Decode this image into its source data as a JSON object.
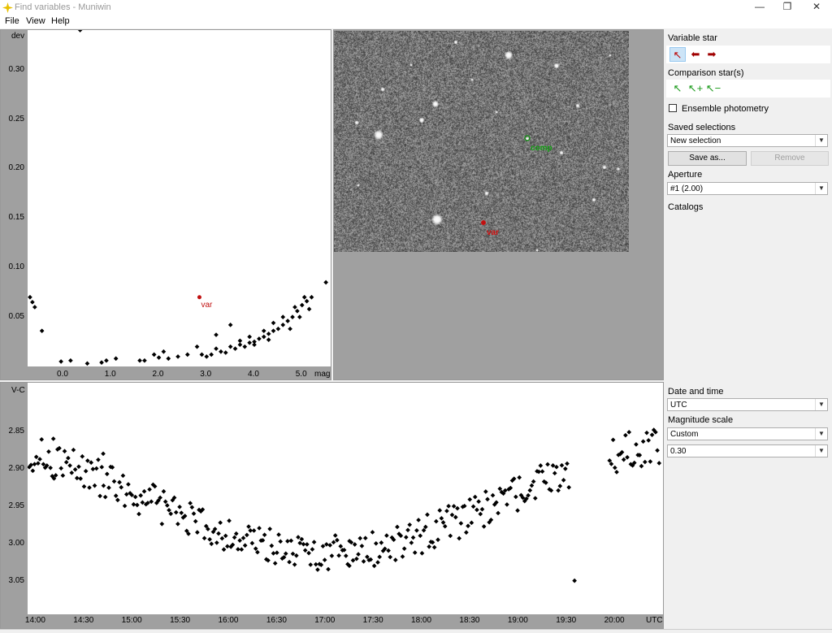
{
  "window": {
    "title": "Find variables - Muniwin",
    "minimize": "—",
    "maximize": "❐",
    "close": "✕"
  },
  "menu": {
    "file": "File",
    "view": "View",
    "help": "Help"
  },
  "top_plot": {
    "ylabel": "dev",
    "xlabel": "mag",
    "yticks": [
      "0.30",
      "0.25",
      "0.20",
      "0.15",
      "0.10",
      "0.05"
    ],
    "xticks": [
      "0.0",
      "1.0",
      "2.0",
      "3.0",
      "4.0",
      "5.0"
    ],
    "var_label": "var"
  },
  "image": {
    "comp_label": "comp",
    "var_label": "var"
  },
  "sidebar": {
    "variable_star": "Variable star",
    "comparison_stars": "Comparison star(s)",
    "ensemble": "Ensemble photometry",
    "saved_selections": "Saved selections",
    "selection_value": "New selection",
    "save_as": "Save as...",
    "remove": "Remove",
    "aperture": "Aperture",
    "aperture_value": "#1 (2.00)",
    "catalogs": "Catalogs",
    "date_time": "Date and time",
    "date_time_value": "UTC",
    "mag_scale": "Magnitude scale",
    "mag_scale_value": "Custom",
    "mag_range_value": "0.30"
  },
  "chart_data": [
    {
      "type": "scatter",
      "title": "",
      "xlabel": "mag",
      "ylabel": "dev",
      "xlim": [
        -0.75,
        5.6
      ],
      "ylim": [
        0.0,
        0.34
      ],
      "points": [
        [
          -0.7,
          0.07
        ],
        [
          -0.65,
          0.065
        ],
        [
          -0.6,
          0.06
        ],
        [
          -0.45,
          0.036
        ],
        [
          0.35,
          0.34
        ],
        [
          -0.05,
          0.005
        ],
        [
          0.15,
          0.006
        ],
        [
          0.5,
          0.003
        ],
        [
          0.8,
          0.004
        ],
        [
          0.9,
          0.006
        ],
        [
          1.1,
          0.008
        ],
        [
          1.6,
          0.006
        ],
        [
          1.7,
          0.006
        ],
        [
          1.9,
          0.012
        ],
        [
          2.1,
          0.015
        ],
        [
          2.2,
          0.008
        ],
        [
          2.4,
          0.01
        ],
        [
          2.6,
          0.012
        ],
        [
          2.8,
          0.02
        ],
        [
          3.0,
          0.01
        ],
        [
          3.1,
          0.012
        ],
        [
          3.2,
          0.018
        ],
        [
          3.3,
          0.015
        ],
        [
          3.4,
          0.014
        ],
        [
          3.5,
          0.02
        ],
        [
          3.6,
          0.018
        ],
        [
          3.7,
          0.022
        ],
        [
          3.8,
          0.02
        ],
        [
          3.9,
          0.024
        ],
        [
          4.0,
          0.025
        ],
        [
          4.1,
          0.028
        ],
        [
          4.2,
          0.03
        ],
        [
          4.3,
          0.033
        ],
        [
          4.4,
          0.036
        ],
        [
          4.5,
          0.038
        ],
        [
          4.6,
          0.042
        ],
        [
          4.7,
          0.046
        ],
        [
          4.8,
          0.05
        ],
        [
          4.9,
          0.056
        ],
        [
          5.0,
          0.062
        ],
        [
          5.1,
          0.066
        ],
        [
          5.2,
          0.07
        ],
        [
          5.5,
          0.085
        ],
        [
          3.5,
          0.042
        ],
        [
          3.2,
          0.032
        ],
        [
          4.6,
          0.05
        ],
        [
          4.85,
          0.06
        ],
        [
          5.05,
          0.07
        ],
        [
          4.4,
          0.044
        ],
        [
          4.2,
          0.036
        ],
        [
          3.9,
          0.03
        ],
        [
          3.7,
          0.026
        ],
        [
          2.0,
          0.009
        ],
        [
          2.9,
          0.012
        ],
        [
          4.0,
          0.022
        ],
        [
          4.3,
          0.027
        ],
        [
          4.75,
          0.038
        ],
        [
          4.95,
          0.05
        ],
        [
          5.15,
          0.058
        ]
      ],
      "highlight": {
        "x": 2.85,
        "y": 0.07,
        "label": "var"
      }
    },
    {
      "type": "scatter",
      "title": "",
      "xlabel": "UTC",
      "ylabel": "V-C",
      "xticks": [
        "14:00",
        "14:30",
        "15:00",
        "15:30",
        "16:00",
        "16:30",
        "17:00",
        "17:30",
        "18:00",
        "18:30",
        "19:00",
        "19:30",
        "20:00"
      ],
      "xlim": [
        835,
        1230
      ],
      "ylim": [
        3.095,
        2.785
      ],
      "generator": "sinusoid with noise: mean 2.94, amplitude 0.07, minimum near 17:00, maxima near 14:50 and 18:45",
      "points": []
    }
  ]
}
